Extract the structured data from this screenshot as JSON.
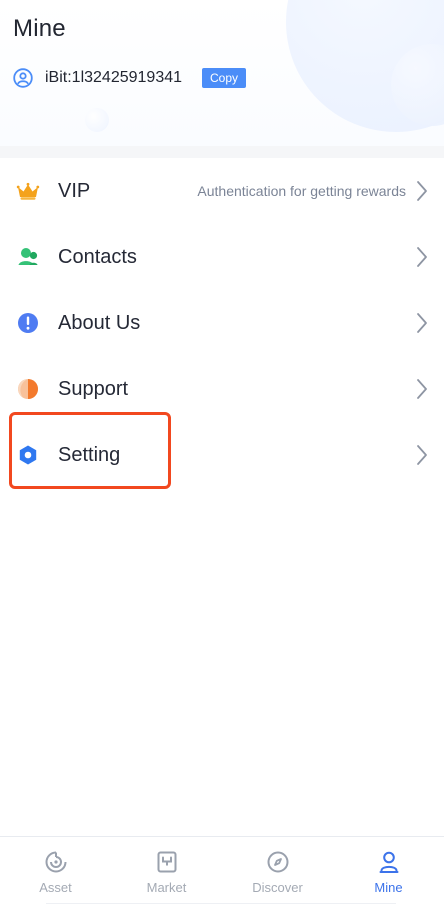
{
  "header": {
    "title": "Mine",
    "user_id_text": "iBit:1l32425919341",
    "copy_label": "Copy"
  },
  "menu": {
    "items": [
      {
        "label": "VIP",
        "hint": "Authentication for getting rewards",
        "icon": "crown-icon"
      },
      {
        "label": "Contacts",
        "hint": "",
        "icon": "contacts-icon"
      },
      {
        "label": "About Us",
        "hint": "",
        "icon": "info-icon"
      },
      {
        "label": "Support",
        "hint": "",
        "icon": "support-icon"
      },
      {
        "label": "Setting",
        "hint": "",
        "icon": "settings-hexagon-icon"
      }
    ]
  },
  "tabs": {
    "items": [
      {
        "label": "Asset",
        "icon": "asset-icon",
        "active": false
      },
      {
        "label": "Market",
        "icon": "market-icon",
        "active": false
      },
      {
        "label": "Discover",
        "icon": "discover-icon",
        "active": false
      },
      {
        "label": "Mine",
        "icon": "profile-icon",
        "active": true
      }
    ]
  },
  "colors": {
    "accent": "#3c73ea",
    "copy_button": "#4b8df8",
    "highlight": "#f2481f",
    "hint": "#7b8496",
    "divider": "#f5f6f8"
  }
}
